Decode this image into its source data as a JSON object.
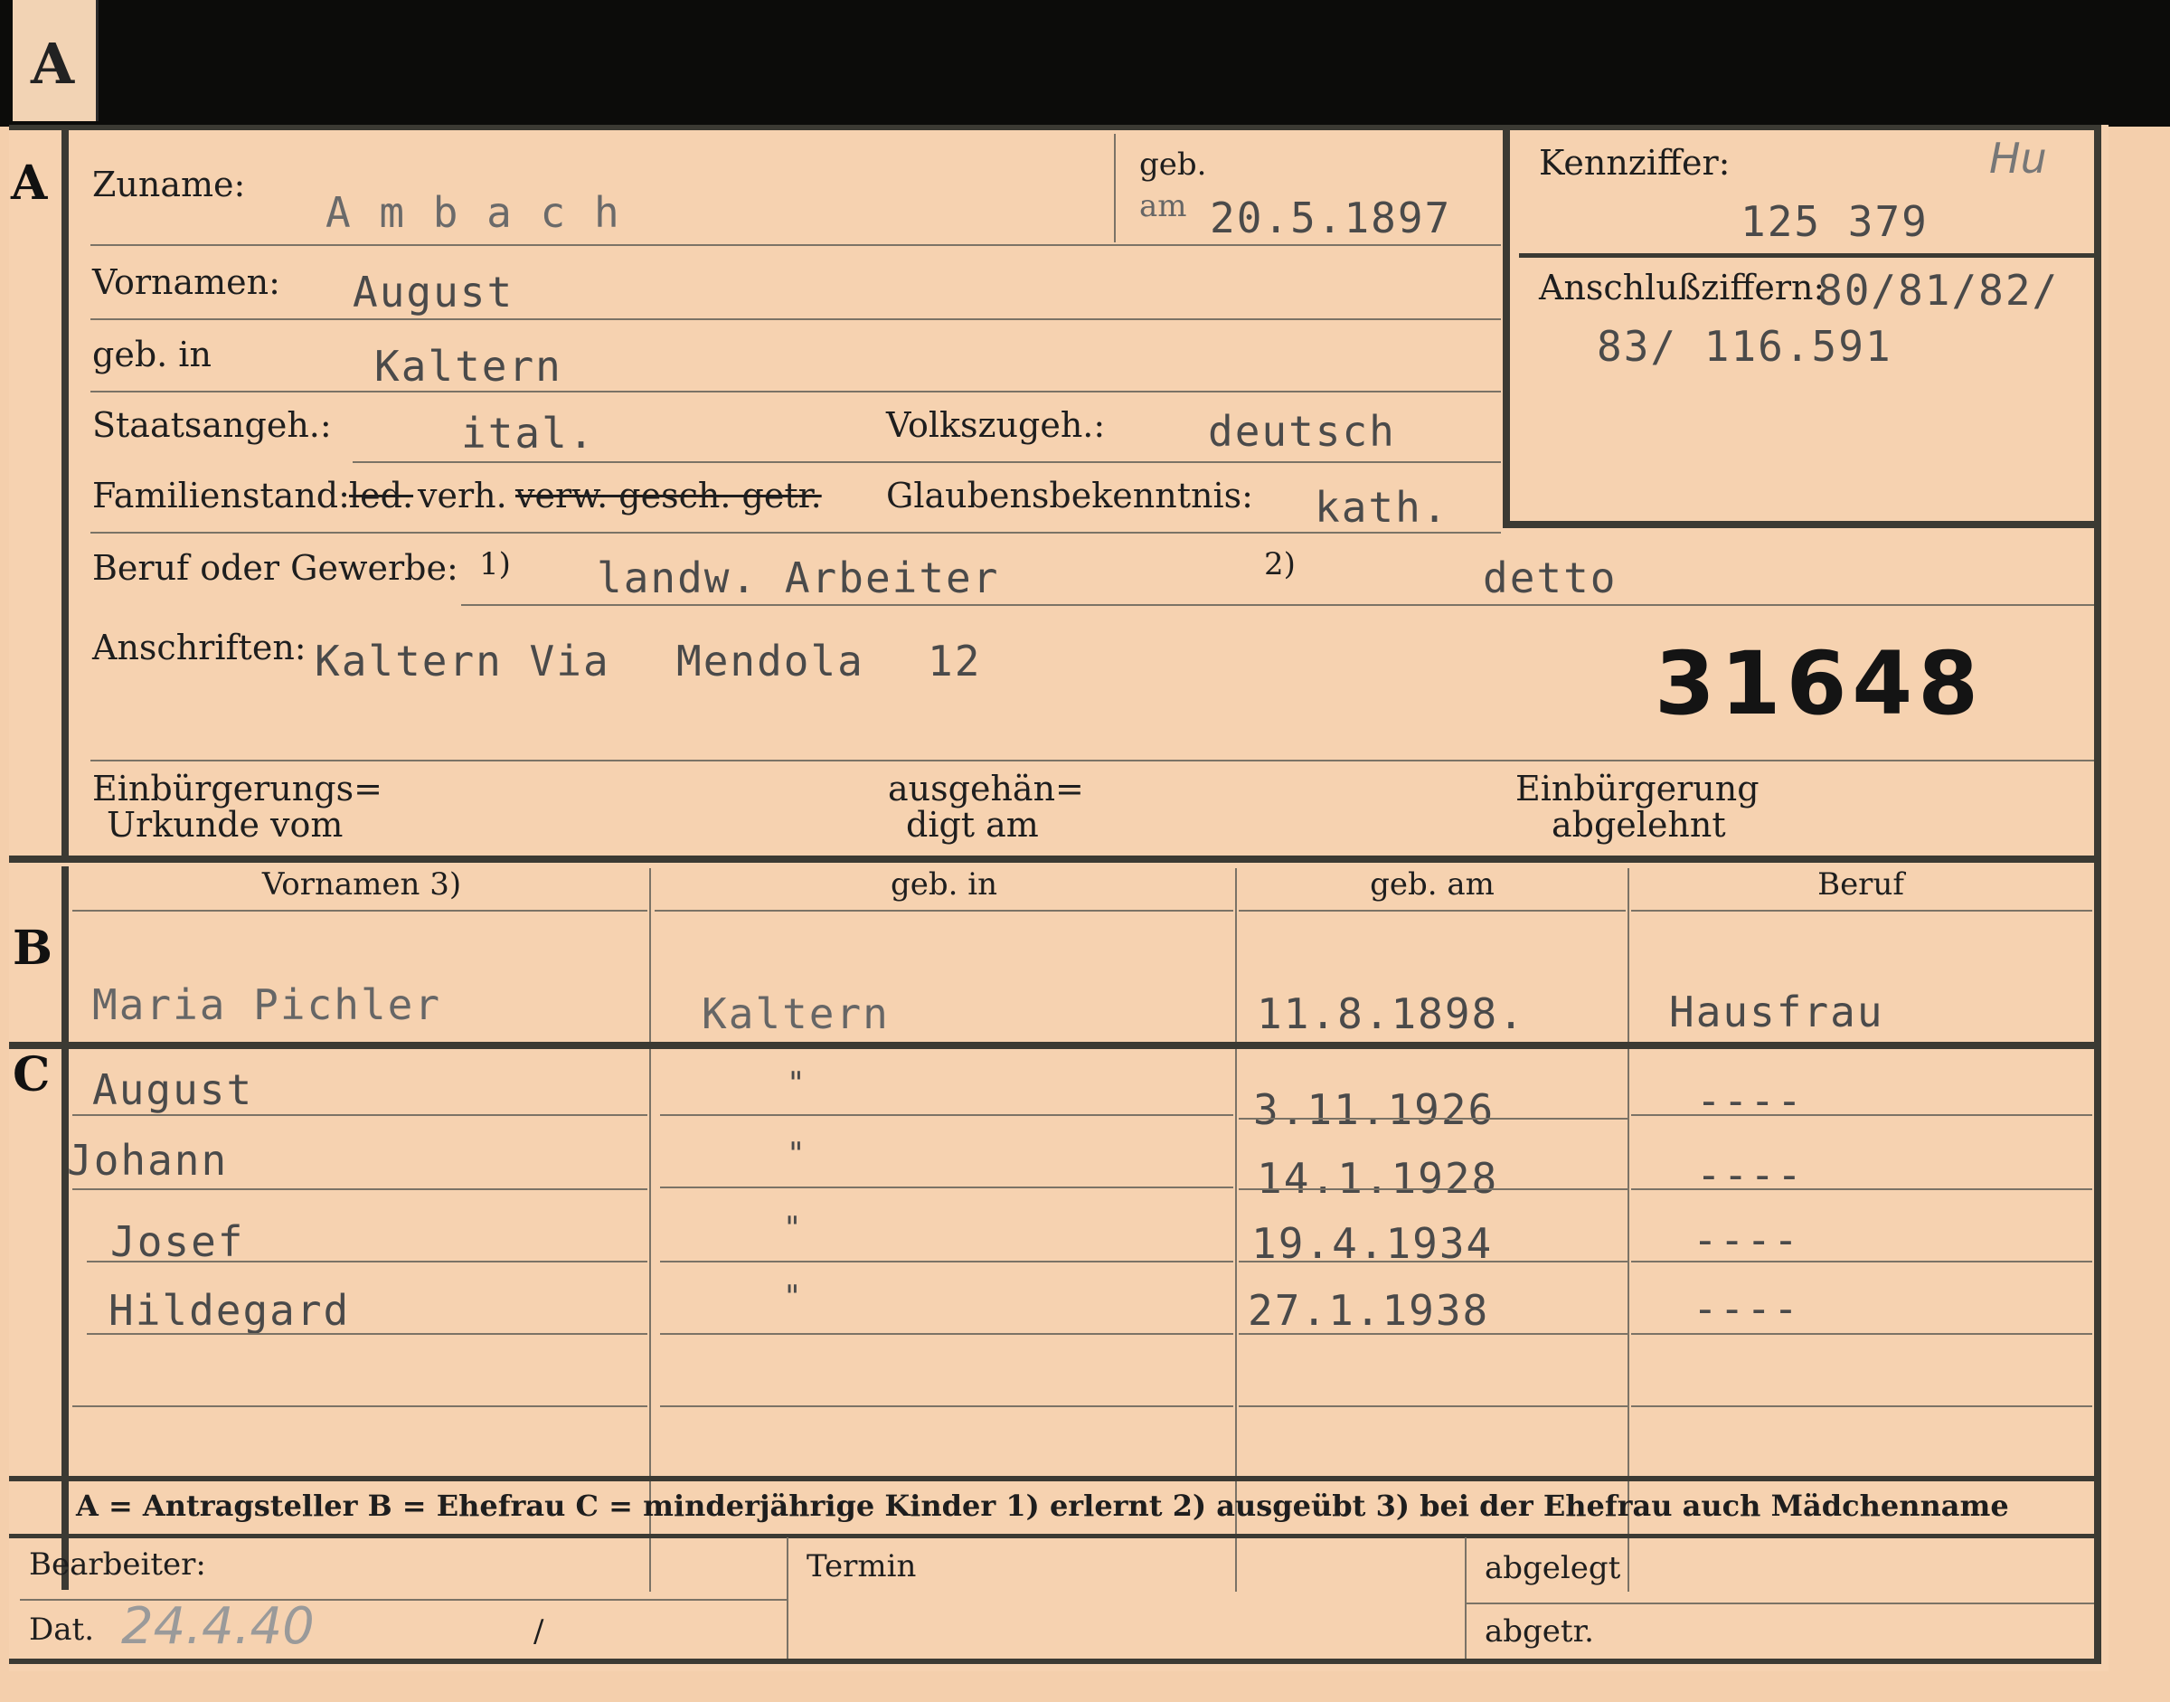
{
  "card": {
    "tab_letter": "A",
    "sections": {
      "a": "A",
      "b": "B",
      "c": "C"
    },
    "labels": {
      "zuname": "Zuname:",
      "geb": "geb.",
      "am": "am",
      "kennziffer": "Kennziffer:",
      "vornamen": "Vornamen:",
      "anschlussziffern": "Anschlußziffern:",
      "geb_in": "geb. in",
      "staatsangeh": "Staatsangeh.:",
      "volkszugeh": "Volkszugeh.:",
      "familienstand": "Familienstand:",
      "familienstand_ledig": "led.",
      "familienstand_verh": "verh.",
      "familienstand_struck": "verw. gesch. getr.",
      "glaubensbekenntnis": "Glaubensbekenntnis:",
      "beruf": "Beruf oder Gewerbe:",
      "fn1": "1)",
      "fn2": "2)",
      "anschriften": "Anschriften:",
      "einbuergerung_urkunde_1": "Einbürgerungs=",
      "einbuergerung_urkunde_2": "Urkunde vom",
      "ausgehaendigt_1": "ausgehän=",
      "ausgehaendigt_2": "digt am",
      "einbuergerung_abgelehnt_1": "Einbürgerung",
      "einbuergerung_abgelehnt_2": "abgelehnt"
    },
    "values": {
      "zuname": "A m b a c h",
      "geb_am": "20.5.1897",
      "kennziffer_mark": "Hu",
      "kennziffer": "125 379",
      "vornamen": "August",
      "anschluss_1": "80/81/82/",
      "anschluss_2": "83/ 116.591",
      "geb_in": "Kaltern",
      "staatsangeh": "ital.",
      "volkszugeh": "deutsch",
      "glaubensbekenntnis": "kath.",
      "beruf_erlernt": "landw. Arbeiter",
      "beruf_ausgeuebt": "detto",
      "anschrift_1": "Kaltern Via",
      "anschrift_2": "Mendola",
      "anschrift_3": "12",
      "stamp_number": "31648"
    },
    "table": {
      "headers": [
        "Vornamen 3)",
        "geb. in",
        "geb. am",
        "Beruf"
      ],
      "ehefrau": {
        "vornamen": "Maria Pichler",
        "geb_in": "Kaltern",
        "geb_am": "11.8.1898.",
        "beruf": "Hausfrau"
      },
      "kinder": [
        {
          "vornamen": "August",
          "geb_in": "\"",
          "geb_am": "3.11.1926",
          "beruf": "----"
        },
        {
          "vornamen": "Johann",
          "geb_in": "\"",
          "geb_am": "14.1.1928",
          "beruf": "----"
        },
        {
          "vornamen": "Josef",
          "geb_in": "\"",
          "geb_am": "19.4.1934",
          "beruf": "----"
        },
        {
          "vornamen": "Hildegard",
          "geb_in": "\"",
          "geb_am": "27.1.1938",
          "beruf": "----"
        }
      ]
    },
    "legend": "A = Antragsteller   B = Ehefrau   C = minderjährige Kinder   1) erlernt   2) ausgeübt   3) bei der Ehefrau auch Mädchenname",
    "footer": {
      "bearbeiter": "Bearbeiter:",
      "dat": "Dat.",
      "dat_value": "24.4.40",
      "slash": "/",
      "termin": "Termin",
      "abgelegt": "abgelegt",
      "abgetr": "abgetr."
    }
  }
}
